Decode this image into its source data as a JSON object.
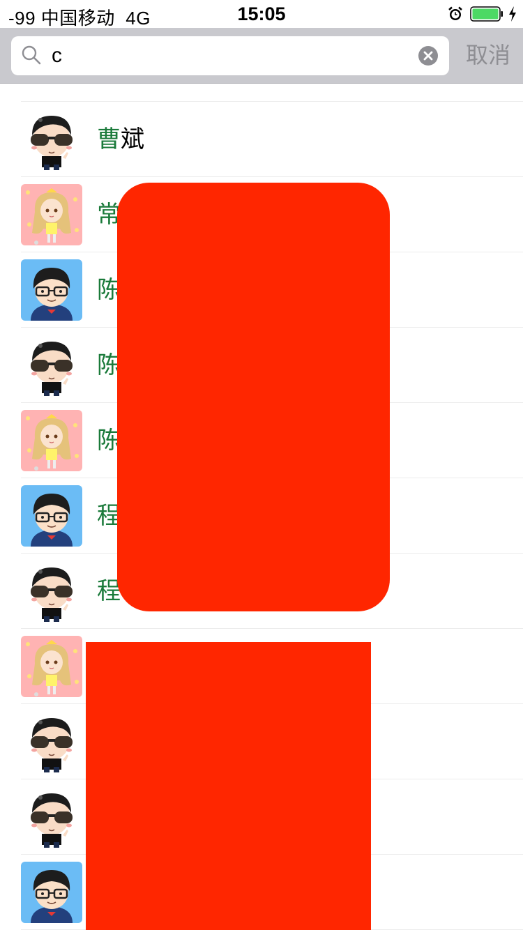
{
  "status_bar": {
    "signal_carrier": "-99 中国移动",
    "network": "4G",
    "time": "15:05",
    "alarm_icon": "alarm-clock-icon",
    "battery_icon": "battery-full-icon",
    "charging_icon": "charging-bolt-icon",
    "battery_color": "#4cd964"
  },
  "search": {
    "query": "c",
    "clear_icon": "clear-circle-icon",
    "search_icon": "magnifier-icon",
    "cancel_label": "取消"
  },
  "contacts": [
    {
      "highlight": "曹",
      "rest": "斌",
      "avatar": "boy-sunglasses"
    },
    {
      "highlight": "常",
      "rest": "",
      "avatar": "girl-pink"
    },
    {
      "highlight": "陈",
      "rest": "",
      "avatar": "boy-blue"
    },
    {
      "highlight": "陈",
      "rest": "",
      "avatar": "boy-sunglasses"
    },
    {
      "highlight": "陈",
      "rest": "",
      "avatar": "girl-pink"
    },
    {
      "highlight": "程",
      "rest": "",
      "avatar": "boy-blue"
    },
    {
      "highlight": "程",
      "rest": "",
      "avatar": "boy-sunglasses"
    },
    {
      "highlight": "",
      "rest": "",
      "avatar": "girl-pink"
    },
    {
      "highlight": "",
      "rest": "",
      "avatar": "boy-sunglasses"
    },
    {
      "highlight": "",
      "rest": "",
      "avatar": "boy-sunglasses"
    },
    {
      "highlight": "",
      "rest": "",
      "avatar": "boy-blue"
    }
  ],
  "colors": {
    "match_highlight": "#1a7a3a",
    "redaction": "#ff2600",
    "search_bar_bg": "#c9c9ce",
    "cancel_text": "#8e8e93"
  }
}
